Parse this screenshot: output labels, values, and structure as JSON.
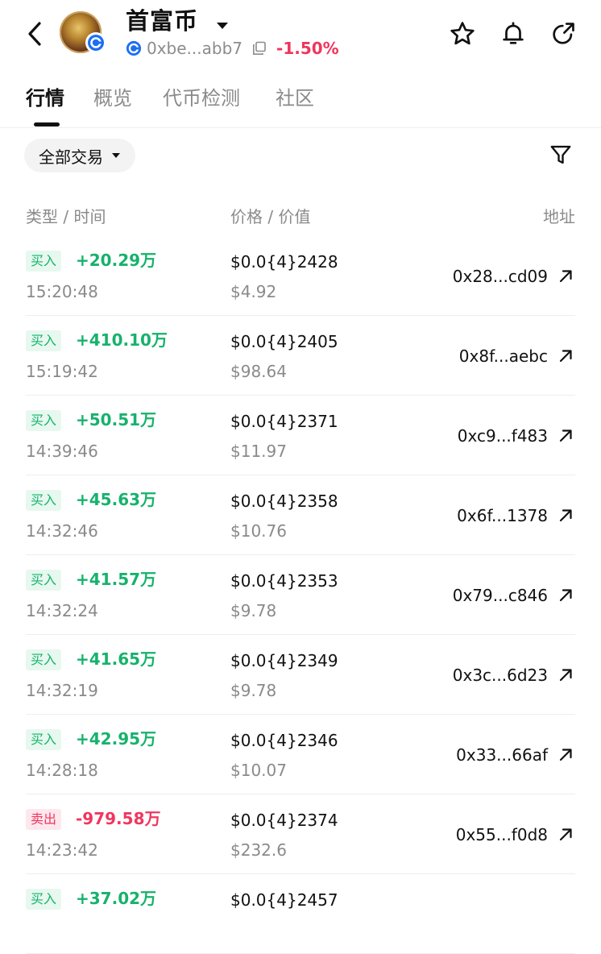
{
  "header": {
    "token_name": "首富币",
    "contract_short": "0xbe...abb7",
    "change": "-1.50%"
  },
  "tabs": [
    {
      "label": "行情",
      "active": true
    },
    {
      "label": "概览",
      "active": false
    },
    {
      "label": "代币检测",
      "active": false
    },
    {
      "label": "社区",
      "active": false
    }
  ],
  "filter": {
    "label": "全部交易"
  },
  "columns": {
    "type_time": "类型 / 时间",
    "price_value": "价格 / 价值",
    "address": "地址"
  },
  "trades": [
    {
      "type": "买入",
      "side": "buy",
      "amount": "+20.29万",
      "time": "15:20:48",
      "price": "$0.0{4}2428",
      "value": "$4.92",
      "address": "0x28...cd09"
    },
    {
      "type": "买入",
      "side": "buy",
      "amount": "+410.10万",
      "time": "15:19:42",
      "price": "$0.0{4}2405",
      "value": "$98.64",
      "address": "0x8f...aebc"
    },
    {
      "type": "买入",
      "side": "buy",
      "amount": "+50.51万",
      "time": "14:39:46",
      "price": "$0.0{4}2371",
      "value": "$11.97",
      "address": "0xc9...f483"
    },
    {
      "type": "买入",
      "side": "buy",
      "amount": "+45.63万",
      "time": "14:32:46",
      "price": "$0.0{4}2358",
      "value": "$10.76",
      "address": "0x6f...1378"
    },
    {
      "type": "买入",
      "side": "buy",
      "amount": "+41.57万",
      "time": "14:32:24",
      "price": "$0.0{4}2353",
      "value": "$9.78",
      "address": "0x79...c846"
    },
    {
      "type": "买入",
      "side": "buy",
      "amount": "+41.65万",
      "time": "14:32:19",
      "price": "$0.0{4}2349",
      "value": "$9.78",
      "address": "0x3c...6d23"
    },
    {
      "type": "买入",
      "side": "buy",
      "amount": "+42.95万",
      "time": "14:28:18",
      "price": "$0.0{4}2346",
      "value": "$10.07",
      "address": "0x33...66af"
    },
    {
      "type": "卖出",
      "side": "sell",
      "amount": "-979.58万",
      "time": "14:23:42",
      "price": "$0.0{4}2374",
      "value": "$232.6",
      "address": "0x55...f0d8"
    },
    {
      "type": "买入",
      "side": "buy",
      "amount": "+37.02万",
      "time": "",
      "price": "$0.0{4}2457",
      "value": "",
      "address": ""
    }
  ],
  "colors": {
    "buy": "#16b26c",
    "sell": "#f0365e",
    "muted": "#8a8a8a"
  }
}
